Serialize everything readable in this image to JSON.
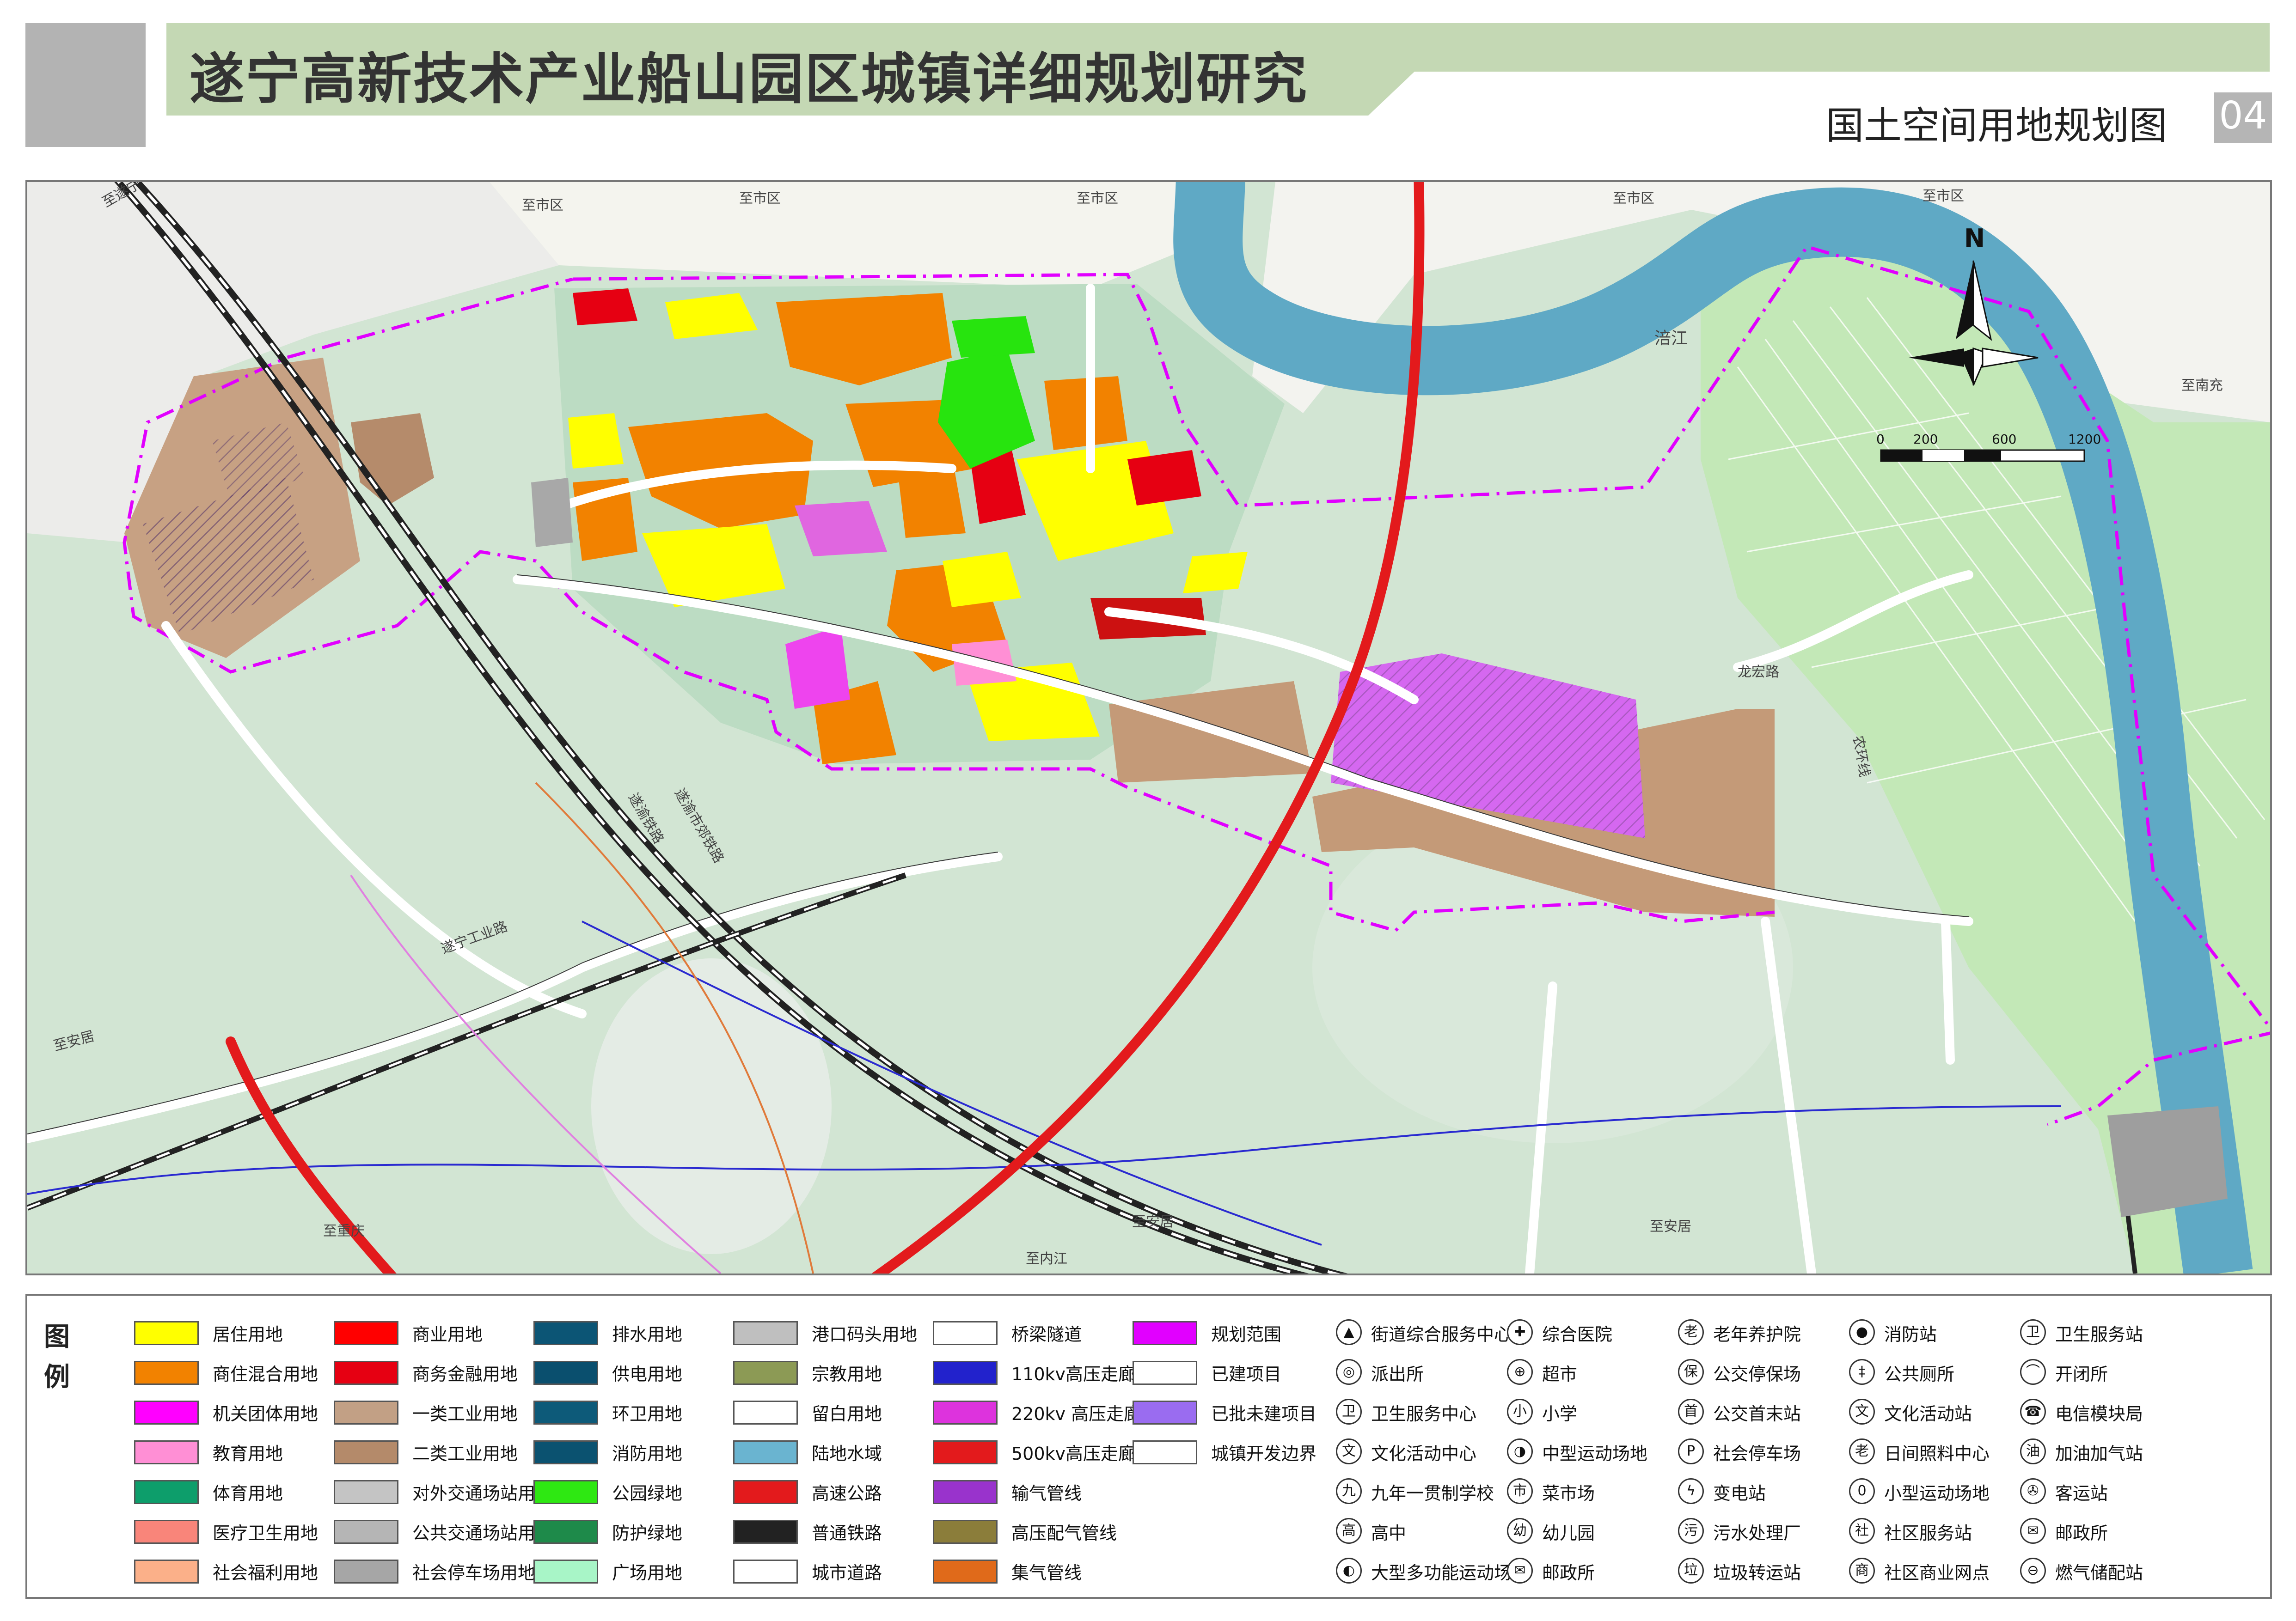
{
  "header": {
    "title": "遂宁高新技术产业船山园区城镇详细规划研究",
    "subtitle": "国土空间用地规划图",
    "page_number": "04"
  },
  "map": {
    "place_labels": [
      {
        "text": "至遂宁"
      },
      {
        "text": "至市区"
      },
      {
        "text": "至市区"
      },
      {
        "text": "至市区"
      },
      {
        "text": "至市区"
      },
      {
        "text": "至市区"
      },
      {
        "text": "至南充"
      },
      {
        "text": "涪江"
      },
      {
        "text": "龙宏路"
      },
      {
        "text": "遂渝铁路"
      },
      {
        "text": "遂渝市郊铁路"
      },
      {
        "text": "遂宁工业路"
      },
      {
        "text": "至安居"
      },
      {
        "text": "至重庆"
      },
      {
        "text": "至内江"
      },
      {
        "text": "至安居"
      },
      {
        "text": "至安居"
      },
      {
        "text": "农环线"
      }
    ],
    "north_label": "N",
    "scale_ticks": [
      "0",
      "200",
      "600",
      "1200"
    ],
    "colors": {
      "forest": "#cfe3d0",
      "river": "#5ea8c4",
      "farmland": "#bfe6b5",
      "urban_outside": "#f2f2ec",
      "residential": "#ffff00",
      "mixed": "#f28200",
      "commercial": "#e60012",
      "industrial": "#c49a78",
      "park": "#27e40e",
      "boundary": "#e100ff",
      "expressway": "#e31a1c"
    }
  },
  "legend": {
    "title_1": "图",
    "title_2": "例",
    "swatches": [
      {
        "label": "居住用地",
        "color": "#ffff00"
      },
      {
        "label": "商住混合用地",
        "color": "#f28200"
      },
      {
        "label": "机关团体用地",
        "color": "#ff00ff"
      },
      {
        "label": "教育用地",
        "color": "#ff8fd5"
      },
      {
        "label": "体育用地",
        "color": "#0d9e6b"
      },
      {
        "label": "医疗卫生用地",
        "color": "#f9857a"
      },
      {
        "label": "社会福利用地",
        "color": "#fbb089"
      },
      {
        "label": "商业用地",
        "color": "#ff0000"
      },
      {
        "label": "商务金融用地",
        "color": "#e60012"
      },
      {
        "label": "一类工业用地",
        "color": "#c2a085"
      },
      {
        "label": "二类工业用地",
        "color": "#b48a6a"
      },
      {
        "label": "对外交通场站用地",
        "color": "#c4c4c4"
      },
      {
        "label": "公共交通场站用地",
        "color": "#b5b5b5"
      },
      {
        "label": "社会停车场用地",
        "color": "#a6a6a6"
      },
      {
        "label": "排水用地",
        "color": "#0c5575"
      },
      {
        "label": "供电用地",
        "color": "#0a4f6e"
      },
      {
        "label": "环卫用地",
        "color": "#0d5a79"
      },
      {
        "label": "消防用地",
        "color": "#0b5270"
      },
      {
        "label": "公园绿地",
        "color": "#2ee812"
      },
      {
        "label": "防护绿地",
        "color": "#1e8a4a"
      },
      {
        "label": "广场用地",
        "color": "#a8f5c7"
      },
      {
        "label": "港口码头用地",
        "color": "#bfbfbf"
      },
      {
        "label": "宗教用地",
        "color": "#8c9a55"
      },
      {
        "label": "留白用地",
        "color": "#ffffff"
      },
      {
        "label": "陆地水域",
        "color": "#6ab4d0"
      },
      {
        "label": "高速公路",
        "color": "#e31a1c"
      },
      {
        "label": "普通铁路",
        "color": "#222222"
      },
      {
        "label": "城市道路",
        "color": "#ffffff"
      },
      {
        "label": "桥梁隧道",
        "color": "#ffffff"
      },
      {
        "label": "110kv高压走廊",
        "color": "#2222cc"
      },
      {
        "label": "220kv 高压走廊",
        "color": "#dd33dd"
      },
      {
        "label": "500kv高压走廊",
        "color": "#e31a1c"
      },
      {
        "label": "输气管线",
        "color": "#9933cc"
      },
      {
        "label": "高压配气管线",
        "color": "#8b7d3a"
      },
      {
        "label": "集气管线",
        "color": "#e06a1a"
      },
      {
        "label": "规划范围",
        "color": "#e100ff"
      },
      {
        "label": "已建项目",
        "color": "#ffffff"
      },
      {
        "label": "已批未建项目",
        "color": "#9a6cf0"
      },
      {
        "label": "城镇开发边界",
        "color": "#ffffff"
      }
    ],
    "icons": [
      {
        "label": "街道综合服务中心",
        "glyph": "▲",
        "icon": "triangle-icon"
      },
      {
        "label": "派出所",
        "glyph": "◎",
        "icon": "police-icon"
      },
      {
        "label": "卫生服务中心",
        "glyph": "卫",
        "icon": "health-center-icon"
      },
      {
        "label": "文化活动中心",
        "glyph": "文",
        "icon": "culture-center-icon"
      },
      {
        "label": "九年一贯制学校",
        "glyph": "九",
        "icon": "school-nine-year-icon"
      },
      {
        "label": "高中",
        "glyph": "高",
        "icon": "high-school-icon"
      },
      {
        "label": "大型多功能运动场地",
        "glyph": "◐",
        "icon": "large-sports-icon"
      },
      {
        "label": "综合医院",
        "glyph": "✚",
        "icon": "hospital-icon"
      },
      {
        "label": "超市",
        "glyph": "⊕",
        "icon": "supermarket-icon"
      },
      {
        "label": "小学",
        "glyph": "小",
        "icon": "primary-school-icon"
      },
      {
        "label": "中型运动场地",
        "glyph": "◑",
        "icon": "medium-sports-icon"
      },
      {
        "label": "菜市场",
        "glyph": "市",
        "icon": "market-icon"
      },
      {
        "label": "幼儿园",
        "glyph": "幼",
        "icon": "kindergarten-icon"
      },
      {
        "label": "邮政所",
        "glyph": "✉",
        "icon": "post-office-icon"
      },
      {
        "label": "老年养护院",
        "glyph": "老",
        "icon": "elderly-home-icon"
      },
      {
        "label": "公交停保场",
        "glyph": "保",
        "icon": "bus-depot-icon"
      },
      {
        "label": "公交首末站",
        "glyph": "首",
        "icon": "bus-terminal-icon"
      },
      {
        "label": "社会停车场",
        "glyph": "P",
        "icon": "parking-icon"
      },
      {
        "label": "变电站",
        "glyph": "ϟ",
        "icon": "substation-icon"
      },
      {
        "label": "污水处理厂",
        "glyph": "污",
        "icon": "sewage-plant-icon"
      },
      {
        "label": "垃圾转运站",
        "glyph": "垃",
        "icon": "garbage-station-icon"
      },
      {
        "label": "消防站",
        "glyph": "●",
        "icon": "fire-station-icon"
      },
      {
        "label": "公共厕所",
        "glyph": "‡",
        "icon": "toilet-icon"
      },
      {
        "label": "文化活动站",
        "glyph": "文",
        "icon": "culture-station-icon"
      },
      {
        "label": "日间照料中心",
        "glyph": "老",
        "icon": "daycare-center-icon"
      },
      {
        "label": "小型运动场地",
        "glyph": "0",
        "icon": "small-sports-icon"
      },
      {
        "label": "社区服务站",
        "glyph": "社",
        "icon": "community-service-icon"
      },
      {
        "label": "社区商业网点",
        "glyph": "商",
        "icon": "community-shop-icon"
      },
      {
        "label": "卫生服务站",
        "glyph": "卫",
        "icon": "health-station-icon"
      },
      {
        "label": "开闭所",
        "glyph": "⌒",
        "icon": "switch-station-icon"
      },
      {
        "label": "电信模块局",
        "glyph": "☎",
        "icon": "telecom-icon"
      },
      {
        "label": "加油加气站",
        "glyph": "油",
        "icon": "gas-station-icon"
      },
      {
        "label": "客运站",
        "glyph": "✇",
        "icon": "passenger-station-icon"
      },
      {
        "label": "邮政所",
        "glyph": "✉",
        "icon": "post-branch-icon"
      },
      {
        "label": "燃气储配站",
        "glyph": "⊖",
        "icon": "gas-storage-icon"
      }
    ]
  }
}
